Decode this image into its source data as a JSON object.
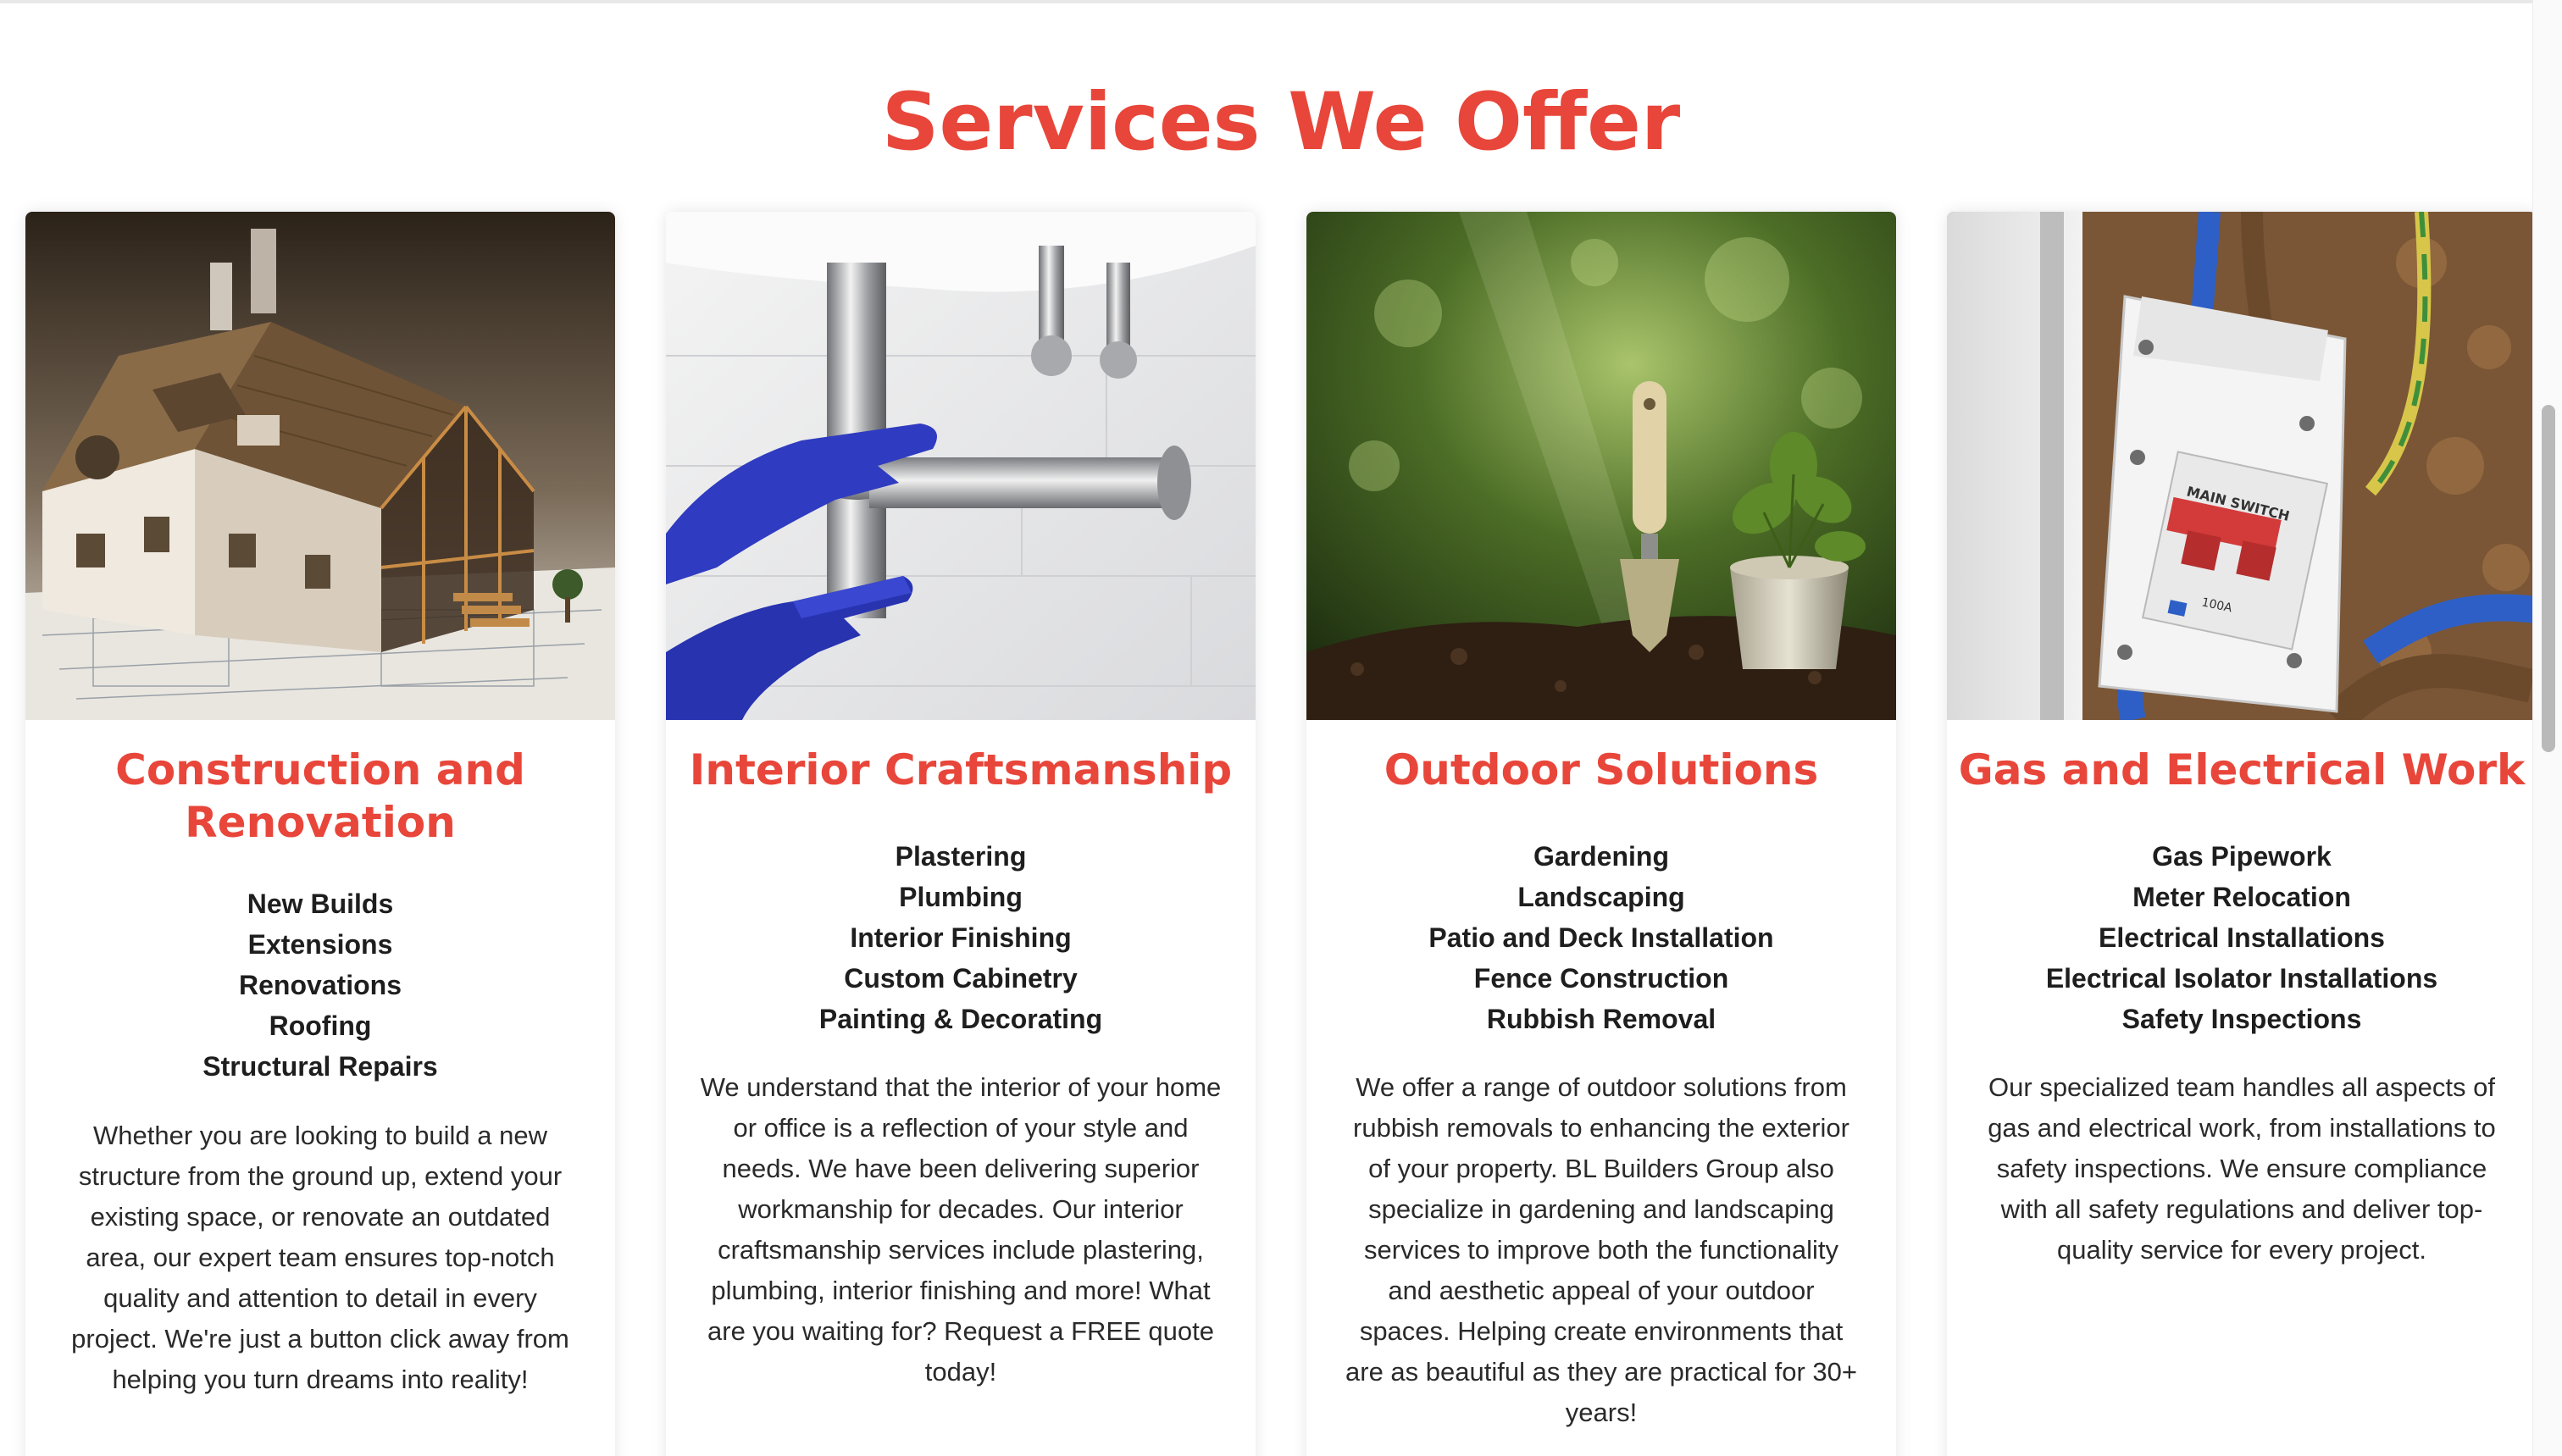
{
  "page": {
    "title": "Services We Offer"
  },
  "colors": {
    "accent": "#e8463a",
    "text": "#222222",
    "background": "#ffffff"
  },
  "cards": [
    {
      "title": "Construction and Renovation",
      "image_icon": "house-construction-image",
      "services": [
        "New Builds",
        "Extensions",
        "Renovations",
        "Roofing",
        "Structural Repairs"
      ],
      "description": "Whether you are looking to build a new structure from the ground up, extend your existing space, or renovate an outdated area, our expert team ensures top-notch quality and attention to detail in every project. We're just a button click away from helping you turn dreams into reality!"
    },
    {
      "title": "Interior Craftsmanship",
      "image_icon": "plumbing-pipe-image",
      "services": [
        "Plastering",
        "Plumbing",
        "Interior Finishing",
        "Custom Cabinetry",
        "Painting & Decorating"
      ],
      "description": "We understand that the interior of your home or office is a reflection of your style and needs. We have been delivering superior workmanship for decades. Our interior craftsmanship services include plastering, plumbing, interior finishing and more! What are you waiting for? Request a FREE quote today!"
    },
    {
      "title": "Outdoor Solutions",
      "image_icon": "garden-trowel-image",
      "services": [
        "Gardening",
        "Landscaping",
        "Patio and Deck Installation",
        "Fence Construction",
        "Rubbish Removal"
      ],
      "description": "We offer a range of outdoor solutions from rubbish removals to enhancing the exterior of your property. BL Builders Group also specialize in gardening and landscaping services to improve both the functionality and aesthetic appeal of your outdoor spaces. Helping create environments that are as beautiful as they are practical for 30+ years!"
    },
    {
      "title": "Gas and Electrical Work",
      "image_icon": "main-switch-image",
      "image_text": "MAIN SWITCH",
      "image_text_rating": "100A",
      "services": [
        "Gas Pipework",
        "Meter Relocation",
        "Electrical Installations",
        "Electrical Isolator Installations",
        "Safety Inspections"
      ],
      "description": "Our specialized team handles all aspects of gas and electrical work, from installations to safety inspections. We ensure compliance with all safety regulations and deliver top-quality service for every project."
    }
  ]
}
